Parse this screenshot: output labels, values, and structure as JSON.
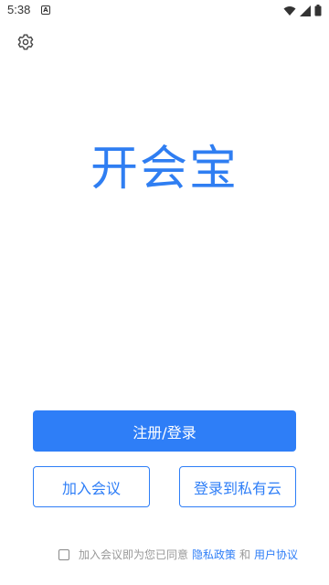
{
  "status_bar": {
    "time": "5:38",
    "notif_letter": "A",
    "icons": [
      "wifi-icon",
      "signal-icon",
      "battery-icon"
    ]
  },
  "header": {
    "settings_icon": "gear-icon"
  },
  "main": {
    "app_title": "开会宝"
  },
  "actions": {
    "register_login_label": "注册/登录",
    "join_meeting_label": "加入会议",
    "private_cloud_label": "登录到私有云"
  },
  "agreement": {
    "prefix": "加入会议即为您已同意",
    "privacy_link": "隐私政策",
    "conjunction": "和",
    "terms_link": "用户协议",
    "checked": false
  },
  "colors": {
    "accent": "#2e7ef7",
    "title": "#2f7ef2",
    "muted": "#999999"
  }
}
